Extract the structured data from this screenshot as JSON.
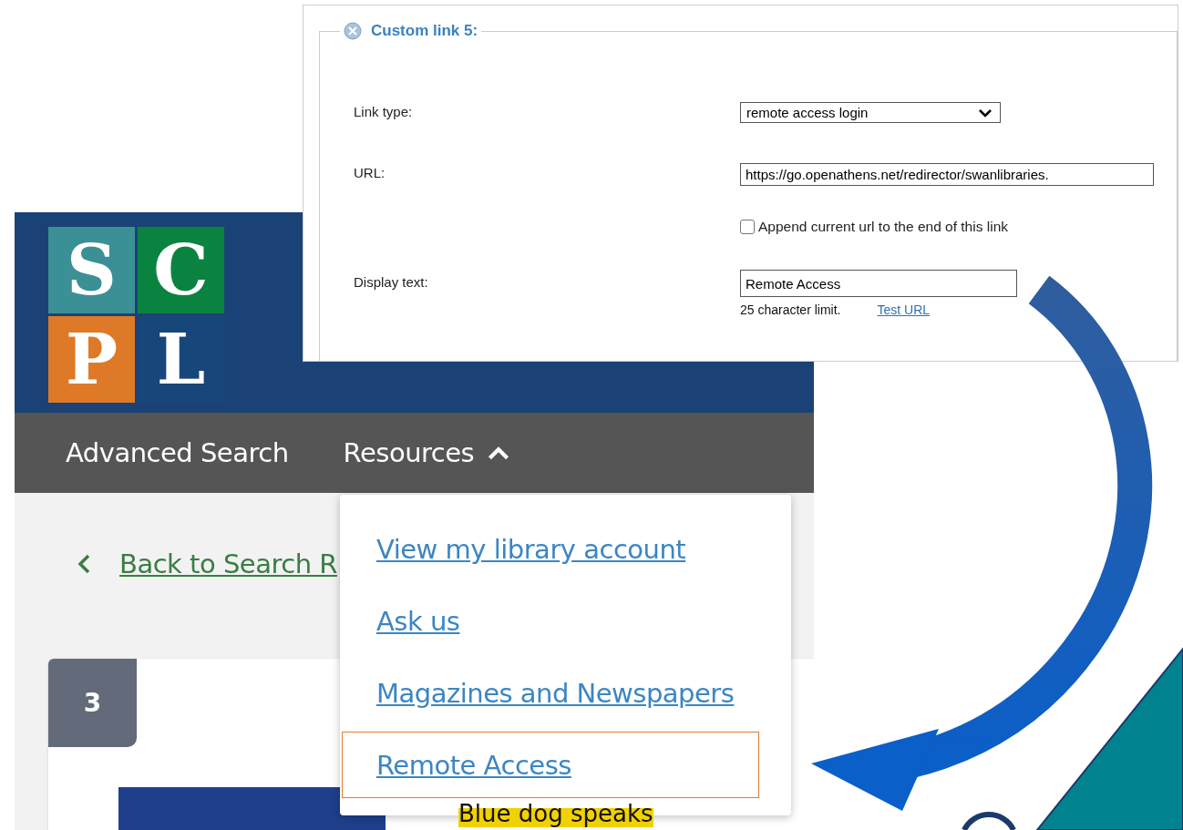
{
  "admin_panel": {
    "legend": "Custom link 5:",
    "fields": [
      {
        "kind": "select",
        "label": "Link type:",
        "value": "remote access login"
      },
      {
        "kind": "text",
        "label": "URL:",
        "value": "https://go.openathens.net/redirector/swanlibraries."
      },
      {
        "kind": "checkbox",
        "label": "Append current url to the end of this link",
        "checked": false
      },
      {
        "kind": "text",
        "label": "Display text:",
        "value": "Remote Access",
        "note": "25 character limit.",
        "link": "Test URL"
      }
    ]
  },
  "website": {
    "logo": {
      "tiles": [
        {
          "letter": "S",
          "color": "#3b9096"
        },
        {
          "letter": "C",
          "color": "#0a8341"
        },
        {
          "letter": "P",
          "color": "#de7a27"
        },
        {
          "letter": "L",
          "color": "#17467a"
        }
      ]
    },
    "nav": [
      {
        "label": "Advanced Search"
      },
      {
        "label": "Resources",
        "expanded": true
      }
    ],
    "back_link": "Back to Search R",
    "dropdown": [
      {
        "label": "View my library account",
        "selected": false
      },
      {
        "label": "Ask us",
        "selected": false
      },
      {
        "label": "Magazines and Newspapers",
        "selected": false
      },
      {
        "label": "Remote Access",
        "selected": true
      }
    ],
    "result": {
      "number": "3",
      "title": "Blue dog speaks"
    }
  }
}
